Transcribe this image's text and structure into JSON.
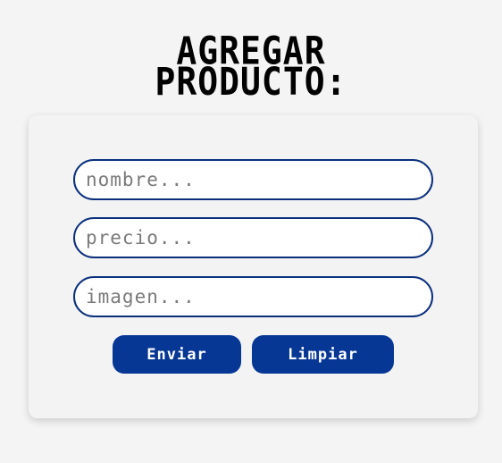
{
  "title": {
    "line1": "AGREGAR",
    "line2": "PRODUCTO:"
  },
  "form": {
    "name_placeholder": "nombre...",
    "price_placeholder": "precio...",
    "image_placeholder": "imagen...",
    "submit_label": "Enviar",
    "clear_label": "Limpiar"
  },
  "colors": {
    "accent": "#063795",
    "field_border": "#0a2f7c",
    "background": "#f4f4f4"
  }
}
